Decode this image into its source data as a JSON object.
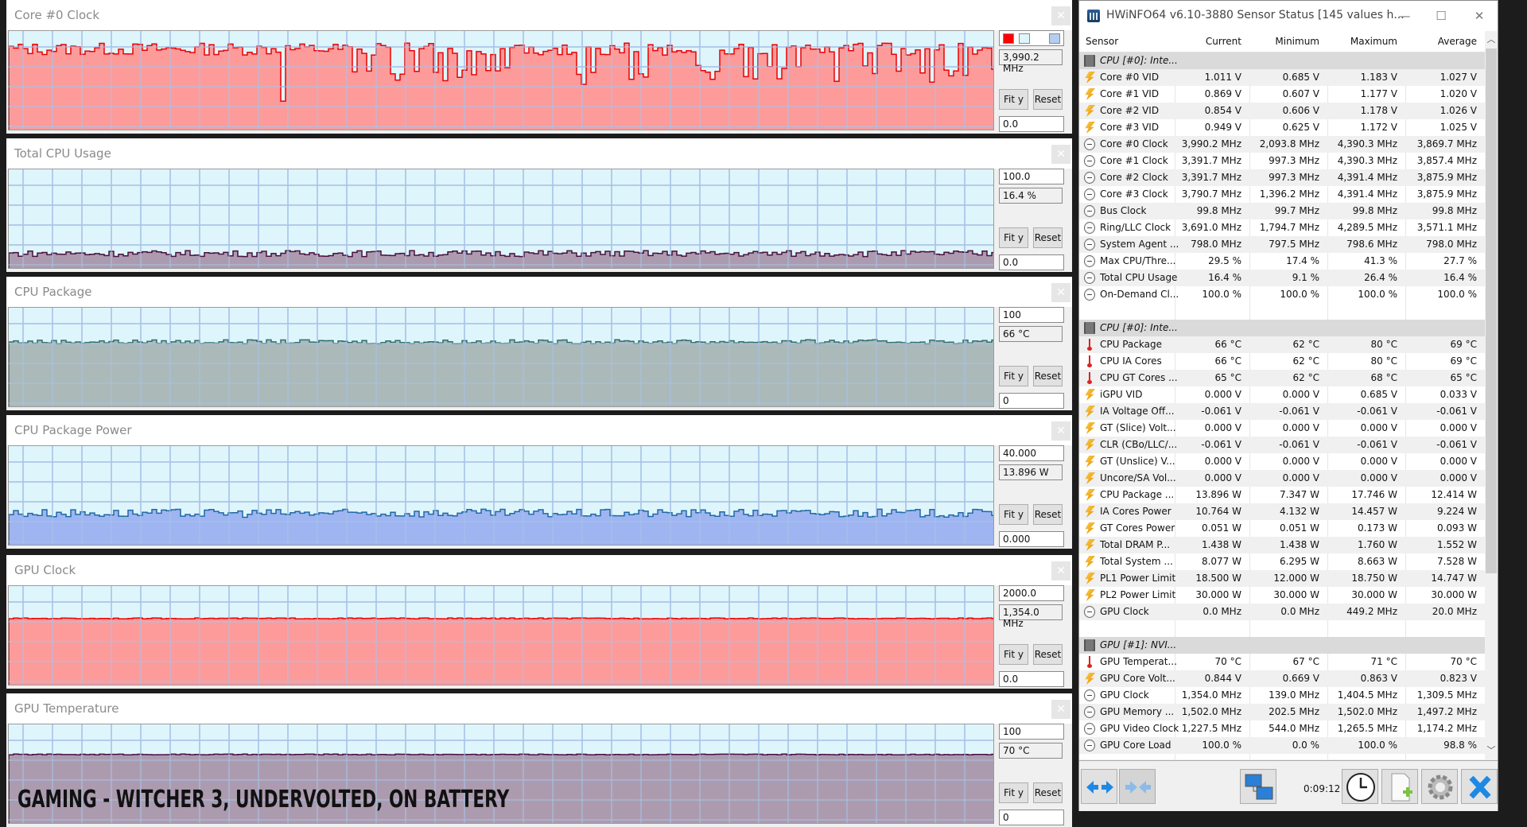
{
  "graphs": [
    {
      "title": "Core #0 Clock",
      "max_field": "",
      "current": "3,990.2 MHz",
      "min_field": "0.0",
      "fit_label": "Fit y",
      "reset_label": "Reset",
      "fill": "#ff9393",
      "line": "#ee0000",
      "show_legend": true,
      "range": [
        0,
        5000
      ],
      "level": 0.82,
      "jitter": 0.06,
      "deep_spikes": true
    },
    {
      "title": "Total CPU Usage",
      "max_field": "100.0",
      "current": "16.4 %",
      "min_field": "0.0",
      "fit_label": "Fit y",
      "reset_label": "Reset",
      "fill": "#a793a8",
      "line": "#4a1040",
      "show_legend": false,
      "range": [
        0,
        100
      ],
      "level": 0.16,
      "jitter": 0.03,
      "deep_spikes": false
    },
    {
      "title": "CPU Package",
      "max_field": "100",
      "current": "66 °C",
      "min_field": "0",
      "fit_label": "Fit y",
      "reset_label": "Reset",
      "fill": "#a6b3b3",
      "line": "#2f7070",
      "show_legend": false,
      "range": [
        0,
        100
      ],
      "level": 0.66,
      "jitter": 0.02,
      "deep_spikes": false
    },
    {
      "title": "CPU Package Power",
      "max_field": "40.000",
      "current": "13.896 W",
      "min_field": "0.000",
      "fit_label": "Fit y",
      "reset_label": "Reset",
      "fill": "#98aff0",
      "line": "#1f6aa5",
      "show_legend": false,
      "range": [
        0,
        40
      ],
      "level": 0.33,
      "jitter": 0.04,
      "deep_spikes": false
    },
    {
      "title": "GPU Clock",
      "max_field": "2000.0",
      "current": "1,354.0 MHz",
      "min_field": "0.0",
      "fit_label": "Fit y",
      "reset_label": "Reset",
      "fill": "#ff9393",
      "line": "#ee0000",
      "show_legend": false,
      "range": [
        0,
        2000
      ],
      "level": 0.677,
      "jitter": 0.005,
      "deep_spikes": false
    },
    {
      "title": "GPU Temperature",
      "max_field": "100",
      "current": "70 °C",
      "min_field": "0",
      "fit_label": "Fit y",
      "reset_label": "Reset",
      "fill": "#a793a8",
      "line": "#4a1040",
      "show_legend": false,
      "range": [
        0,
        100
      ],
      "level": 0.7,
      "jitter": 0.004,
      "deep_spikes": false
    }
  ],
  "overlay_caption": "GAMING - WITCHER 3, UNDERVOLTED, ON BATTERY",
  "hwinfo": {
    "title": "HWiNFO64 v6.10-3880 Sensor Status [145 values h...",
    "columns": [
      "Sensor",
      "Current",
      "Minimum",
      "Maximum",
      "Average"
    ],
    "rows": [
      {
        "type": "group",
        "icon": "chip",
        "name": "CPU [#0]: Inte..."
      },
      {
        "icon": "bolt",
        "name": "Core #0 VID",
        "cur": "1.011 V",
        "min": "0.685 V",
        "max": "1.183 V",
        "avg": "1.027 V"
      },
      {
        "icon": "bolt",
        "name": "Core #1 VID",
        "cur": "0.869 V",
        "min": "0.607 V",
        "max": "1.177 V",
        "avg": "1.020 V"
      },
      {
        "icon": "bolt",
        "name": "Core #2 VID",
        "cur": "0.854 V",
        "min": "0.606 V",
        "max": "1.178 V",
        "avg": "1.026 V"
      },
      {
        "icon": "bolt",
        "name": "Core #3 VID",
        "cur": "0.949 V",
        "min": "0.625 V",
        "max": "1.172 V",
        "avg": "1.025 V"
      },
      {
        "icon": "clock",
        "name": "Core #0 Clock",
        "cur": "3,990.2 MHz",
        "min": "2,093.8 MHz",
        "max": "4,390.3 MHz",
        "avg": "3,869.7 MHz"
      },
      {
        "icon": "clock",
        "name": "Core #1 Clock",
        "cur": "3,391.7 MHz",
        "min": "997.3 MHz",
        "max": "4,390.3 MHz",
        "avg": "3,857.4 MHz"
      },
      {
        "icon": "clock",
        "name": "Core #2 Clock",
        "cur": "3,391.7 MHz",
        "min": "997.3 MHz",
        "max": "4,391.4 MHz",
        "avg": "3,875.9 MHz"
      },
      {
        "icon": "clock",
        "name": "Core #3 Clock",
        "cur": "3,790.7 MHz",
        "min": "1,396.2 MHz",
        "max": "4,391.4 MHz",
        "avg": "3,875.9 MHz"
      },
      {
        "icon": "clock",
        "name": "Bus Clock",
        "cur": "99.8 MHz",
        "min": "99.7 MHz",
        "max": "99.8 MHz",
        "avg": "99.8 MHz"
      },
      {
        "icon": "clock",
        "name": "Ring/LLC Clock",
        "cur": "3,691.0 MHz",
        "min": "1,794.7 MHz",
        "max": "4,289.5 MHz",
        "avg": "3,571.1 MHz"
      },
      {
        "icon": "clock",
        "name": "System Agent ...",
        "cur": "798.0 MHz",
        "min": "797.5 MHz",
        "max": "798.6 MHz",
        "avg": "798.0 MHz"
      },
      {
        "icon": "clock",
        "name": "Max CPU/Thre...",
        "cur": "29.5 %",
        "min": "17.4 %",
        "max": "41.3 %",
        "avg": "27.7 %"
      },
      {
        "icon": "clock",
        "name": "Total CPU Usage",
        "cur": "16.4 %",
        "min": "9.1 %",
        "max": "26.4 %",
        "avg": "16.4 %"
      },
      {
        "icon": "clock",
        "name": "On-Demand Cl...",
        "cur": "100.0 %",
        "min": "100.0 %",
        "max": "100.0 %",
        "avg": "100.0 %"
      },
      {
        "type": "blank"
      },
      {
        "type": "group",
        "icon": "chip",
        "name": "CPU [#0]: Inte..."
      },
      {
        "icon": "therm",
        "name": "CPU Package",
        "cur": "66 °C",
        "min": "62 °C",
        "max": "80 °C",
        "avg": "69 °C"
      },
      {
        "icon": "therm",
        "name": "CPU IA Cores",
        "cur": "66 °C",
        "min": "62 °C",
        "max": "80 °C",
        "avg": "69 °C"
      },
      {
        "icon": "therm",
        "name": "CPU GT Cores ...",
        "cur": "65 °C",
        "min": "62 °C",
        "max": "68 °C",
        "avg": "65 °C"
      },
      {
        "icon": "bolt",
        "name": "iGPU VID",
        "cur": "0.000 V",
        "min": "0.000 V",
        "max": "0.685 V",
        "avg": "0.033 V"
      },
      {
        "icon": "bolt",
        "name": "IA Voltage Off...",
        "cur": "-0.061 V",
        "min": "-0.061 V",
        "max": "-0.061 V",
        "avg": "-0.061 V"
      },
      {
        "icon": "bolt",
        "name": "GT (Slice) Volt...",
        "cur": "0.000 V",
        "min": "0.000 V",
        "max": "0.000 V",
        "avg": "0.000 V"
      },
      {
        "icon": "bolt",
        "name": "CLR (CBo/LLC/...",
        "cur": "-0.061 V",
        "min": "-0.061 V",
        "max": "-0.061 V",
        "avg": "-0.061 V"
      },
      {
        "icon": "bolt",
        "name": "GT (Unslice) V...",
        "cur": "0.000 V",
        "min": "0.000 V",
        "max": "0.000 V",
        "avg": "0.000 V"
      },
      {
        "icon": "bolt",
        "name": "Uncore/SA Vol...",
        "cur": "0.000 V",
        "min": "0.000 V",
        "max": "0.000 V",
        "avg": "0.000 V"
      },
      {
        "icon": "bolt",
        "name": "CPU Package ...",
        "cur": "13.896 W",
        "min": "7.347 W",
        "max": "17.746 W",
        "avg": "12.414 W"
      },
      {
        "icon": "bolt",
        "name": "IA Cores Power",
        "cur": "10.764 W",
        "min": "4.132 W",
        "max": "14.457 W",
        "avg": "9.224 W"
      },
      {
        "icon": "bolt",
        "name": "GT Cores Power",
        "cur": "0.051 W",
        "min": "0.051 W",
        "max": "0.173 W",
        "avg": "0.093 W"
      },
      {
        "icon": "bolt",
        "name": "Total DRAM P...",
        "cur": "1.438 W",
        "min": "1.438 W",
        "max": "1.760 W",
        "avg": "1.552 W"
      },
      {
        "icon": "bolt",
        "name": "Total System ...",
        "cur": "8.077 W",
        "min": "6.295 W",
        "max": "8.663 W",
        "avg": "7.528 W"
      },
      {
        "icon": "bolt",
        "name": "PL1 Power Limit",
        "cur": "18.500 W",
        "min": "12.000 W",
        "max": "18.750 W",
        "avg": "14.747 W"
      },
      {
        "icon": "bolt",
        "name": "PL2 Power Limit",
        "cur": "30.000 W",
        "min": "30.000 W",
        "max": "30.000 W",
        "avg": "30.000 W"
      },
      {
        "icon": "clock",
        "name": "GPU Clock",
        "cur": "0.0 MHz",
        "min": "0.0 MHz",
        "max": "449.2 MHz",
        "avg": "20.0 MHz"
      },
      {
        "type": "blank"
      },
      {
        "type": "group",
        "icon": "chip",
        "name": "GPU [#1]: NVI..."
      },
      {
        "icon": "therm",
        "name": "GPU Temperat...",
        "cur": "70 °C",
        "min": "67 °C",
        "max": "71 °C",
        "avg": "70 °C"
      },
      {
        "icon": "bolt",
        "name": "GPU Core Volt...",
        "cur": "0.844 V",
        "min": "0.669 V",
        "max": "0.863 V",
        "avg": "0.823 V"
      },
      {
        "icon": "clock",
        "name": "GPU Clock",
        "cur": "1,354.0 MHz",
        "min": "139.0 MHz",
        "max": "1,404.5 MHz",
        "avg": "1,309.5 MHz"
      },
      {
        "icon": "clock",
        "name": "GPU Memory ...",
        "cur": "1,502.0 MHz",
        "min": "202.5 MHz",
        "max": "1,502.0 MHz",
        "avg": "1,497.2 MHz"
      },
      {
        "icon": "clock",
        "name": "GPU Video Clock",
        "cur": "1,227.5 MHz",
        "min": "544.0 MHz",
        "max": "1,265.5 MHz",
        "avg": "1,174.2 MHz"
      },
      {
        "icon": "clock",
        "name": "GPU Core Load",
        "cur": "100.0 %",
        "min": "0.0 %",
        "max": "100.0 %",
        "avg": "98.8 %"
      }
    ],
    "timer": "0:09:12"
  }
}
